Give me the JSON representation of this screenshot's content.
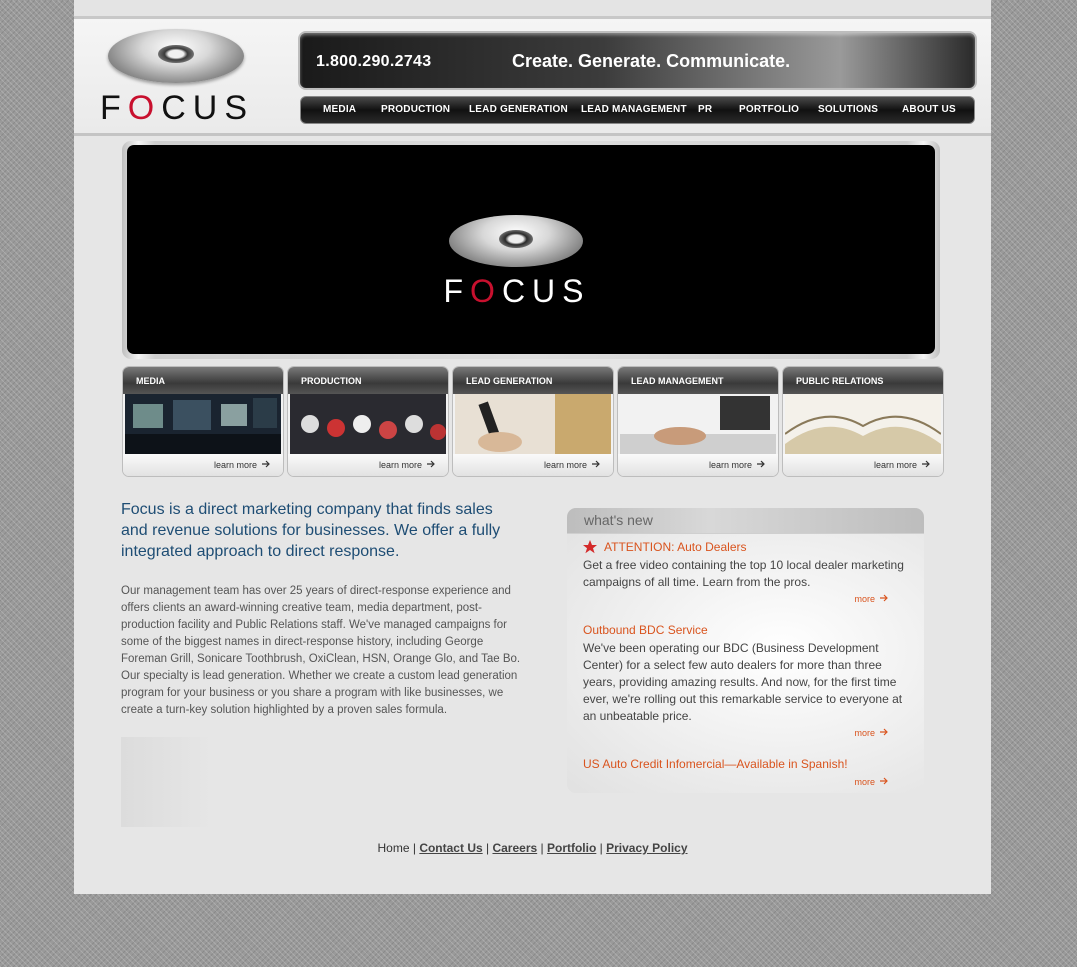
{
  "logo": {
    "letters": [
      "F",
      "O",
      "C",
      "U",
      "S"
    ]
  },
  "header": {
    "phone": "1.800.290.2743",
    "tagline": "Create. Generate. Communicate."
  },
  "nav": {
    "items": [
      "MEDIA",
      "PRODUCTION",
      "LEAD GENERATION",
      "LEAD MANAGEMENT",
      "PR",
      "PORTFOLIO",
      "SOLUTIONS",
      "ABOUT US"
    ]
  },
  "tiles": [
    {
      "title": "MEDIA",
      "link": "learn more"
    },
    {
      "title": "PRODUCTION",
      "link": "learn more"
    },
    {
      "title": "LEAD GENERATION",
      "link": "learn more"
    },
    {
      "title": "LEAD MANAGEMENT",
      "link": "learn more"
    },
    {
      "title": "PUBLIC RELATIONS",
      "link": "learn more"
    }
  ],
  "main": {
    "intro": "Focus is a direct marketing company that finds sales and revenue solutions for businesses. We offer a fully integrated approach to direct response.",
    "body": "Our management team has over 25 years of direct-response experience and offers clients an award-winning creative team, media department, post-production facility and Public Relations staff. We've managed campaigns for some of the biggest names in direct-response history, including George Foreman Grill, Sonicare Toothbrush, OxiClean, HSN, Orange Glo, and Tae Bo. Our specialty is lead generation. Whether we create a custom lead generation program for your business or you share a program with like businesses, we create a turn-key solution highlighted by a proven sales formula."
  },
  "news": {
    "heading": "what's new",
    "items": [
      {
        "title": "ATTENTION: Auto Dealers",
        "text": "Get a free video containing the top 10 local dealer marketing campaigns of all time. Learn from the pros.",
        "more": "more"
      },
      {
        "title": "Outbound BDC Service",
        "text": "We've been operating our BDC (Business Development Center) for a select few auto dealers for more than three years, providing amazing results. And now, for the first time ever, we're rolling out this remarkable service to everyone at an unbeatable price.",
        "more": "more"
      },
      {
        "title": "US Auto Credit Infomercial—Available in Spanish!",
        "text": "",
        "more": "more"
      }
    ]
  },
  "footer": {
    "home": "Home",
    "sep": "|",
    "links": [
      "Contact Us",
      "Careers",
      "Portfolio",
      "Privacy Policy"
    ]
  },
  "colors": {
    "brand_red": "#c8102e",
    "link_orange": "#d9541e",
    "intro_blue": "#1e4d74"
  }
}
